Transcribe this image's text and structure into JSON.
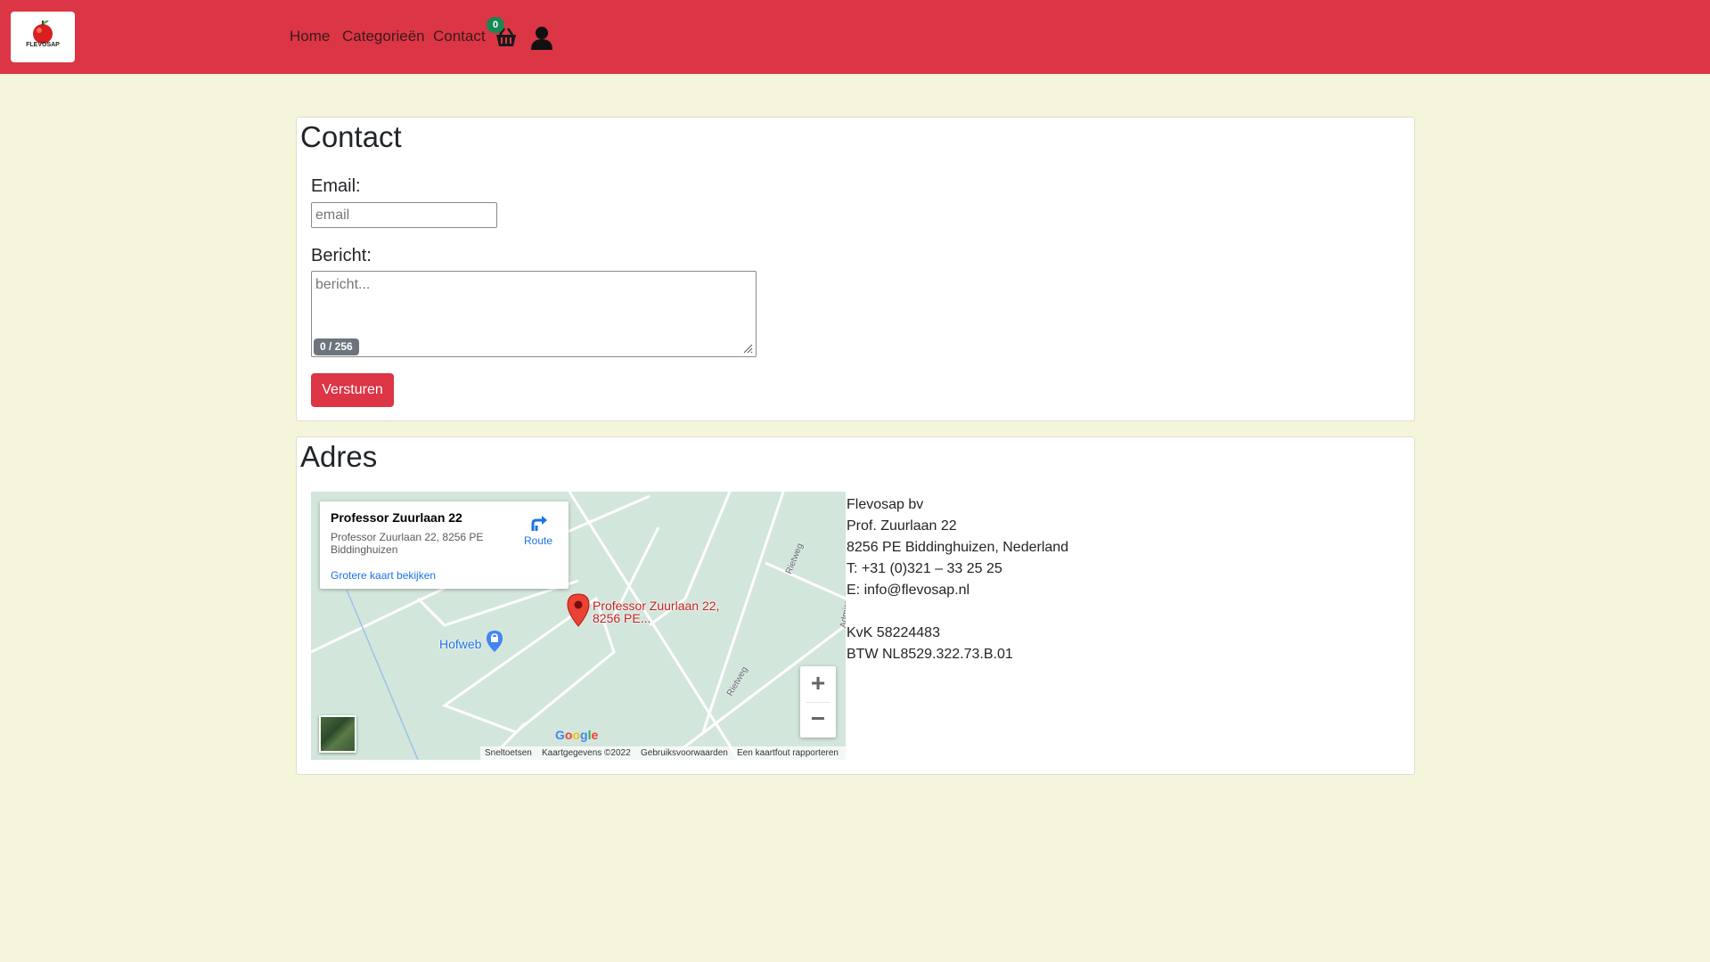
{
  "nav": {
    "logo_text": "FLEVOSAP",
    "links": [
      "Home",
      "Categorieën",
      "Contact"
    ],
    "cart_count": "0",
    "colors": {
      "navbar": "#dc3545",
      "badge": "#198754"
    },
    "icons": [
      "cart-icon",
      "user-icon"
    ]
  },
  "contact": {
    "title": "Contact",
    "email_label": "Email:",
    "email_placeholder": "email",
    "message_label": "Bericht:",
    "message_placeholder": "bericht...",
    "counter": "0 / 256",
    "submit_label": "Versturen"
  },
  "adres": {
    "title": "Adres",
    "map": {
      "info_title": "Professor Zuurlaan 22",
      "info_address": "Professor Zuurlaan 22, 8256 PE Biddinghuizen",
      "info_link": "Grotere kaart bekijken",
      "route_label": "Route",
      "pin_label": "Professor Zuurlaan 22, 8256 PE...",
      "poi_label": "Hofweb",
      "road_labels": [
        "Rietweg",
        "Rietweg",
        "Admiraal"
      ],
      "zoom_in": "+",
      "zoom_out": "−",
      "google_logo": "Google",
      "footer": [
        "Sneltoetsen",
        "Kaartgegevens ©2022",
        "Gebruiksvoorwaarden",
        "Een kaartfout rapporteren"
      ]
    },
    "lines": [
      "Flevosap bv",
      "Prof. Zuurlaan 22",
      "8256 PE Biddinghuizen, Nederland",
      "T: +31 (0)321 – 33 25 25",
      "E: info@flevosap.nl",
      "",
      "KvK 58224483",
      "BTW NL8529.322.73.B.01"
    ]
  },
  "page": {
    "background": "#f5f5dc"
  }
}
